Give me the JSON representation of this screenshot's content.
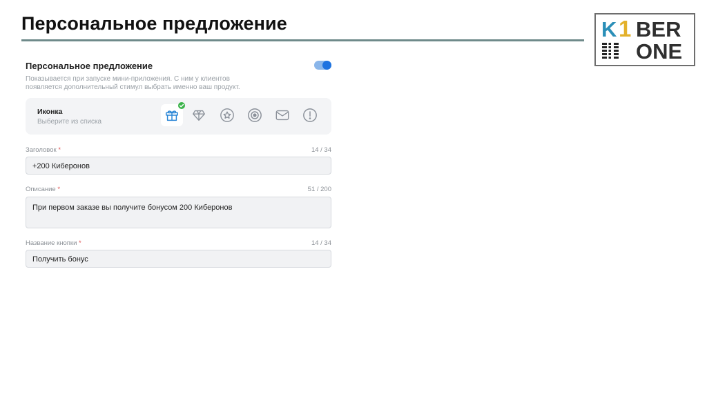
{
  "slide": {
    "title": "Персональное предложение"
  },
  "logo": {
    "letter_k": "K",
    "digit": "1",
    "word_ber": "BER",
    "word_one": "ONE",
    "colors": {
      "k": "#2b8fb8",
      "one": "#e3b12b",
      "text": "#2f2f2f"
    }
  },
  "panel": {
    "title": "Персональное предложение",
    "description": "Показывается при запуске мини-приложения. С ним у клиентов появляется дополнительный стимул выбрать именно ваш продукт.",
    "toggle_on": true,
    "accent_color": "#1e73e0"
  },
  "icon_picker": {
    "label": "Иконка",
    "hint": "Выберите из списка",
    "options": [
      {
        "icon": "gift-icon",
        "selected": true
      },
      {
        "icon": "diamond-icon",
        "selected": false
      },
      {
        "icon": "star-icon",
        "selected": false
      },
      {
        "icon": "target-icon",
        "selected": false
      },
      {
        "icon": "mail-icon",
        "selected": false
      },
      {
        "icon": "exclamation-icon",
        "selected": false
      }
    ]
  },
  "fields": {
    "title": {
      "label": "Заголовок",
      "required_mark": "*",
      "counter": "14 / 34",
      "value": "+200 Киберонов"
    },
    "description": {
      "label": "Описание",
      "required_mark": "*",
      "counter": "51 / 200",
      "value": "При первом заказе вы получите бонусом 200 Киберонов"
    },
    "button": {
      "label": "Название кнопки",
      "required_mark": "*",
      "counter": "14 / 34",
      "value": "Получить бонус"
    }
  }
}
